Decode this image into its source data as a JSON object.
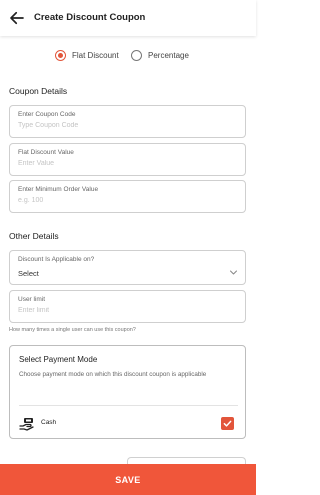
{
  "header": {
    "title": "Create Discount Coupon",
    "back_icon": "arrow-left-icon"
  },
  "discount_type": {
    "options": [
      {
        "label": "Flat Discount",
        "selected": true
      },
      {
        "label": "Percentage",
        "selected": false
      }
    ]
  },
  "coupon_details": {
    "heading": "Coupon Details",
    "code": {
      "label": "Enter Coupon Code",
      "placeholder": "Type Coupon Code",
      "value": ""
    },
    "flat_value": {
      "label": "Flat Discount Value",
      "placeholder": "Enter Value",
      "value": ""
    },
    "min_order": {
      "label": "Enter Minimum Order Value",
      "placeholder": "e.g. 100",
      "value": ""
    }
  },
  "other_details": {
    "heading": "Other Details",
    "applicable_on": {
      "label": "Discount Is Applicable on?",
      "value": "Select"
    },
    "user_limit": {
      "label": "User limit",
      "placeholder": "Enter limit",
      "value": ""
    },
    "helper": "How many times a single user can use this coupon?"
  },
  "payment_mode": {
    "title": "Select Payment Mode",
    "description": "Choose payment mode on which this discount coupon is applicable",
    "options": [
      {
        "label": "Cash",
        "icon": "cash-hand-icon",
        "checked": true
      }
    ]
  },
  "footer": {
    "save_label": "SAVE"
  },
  "colors": {
    "accent": "#f0563a",
    "radio_accent": "#e2553a"
  }
}
